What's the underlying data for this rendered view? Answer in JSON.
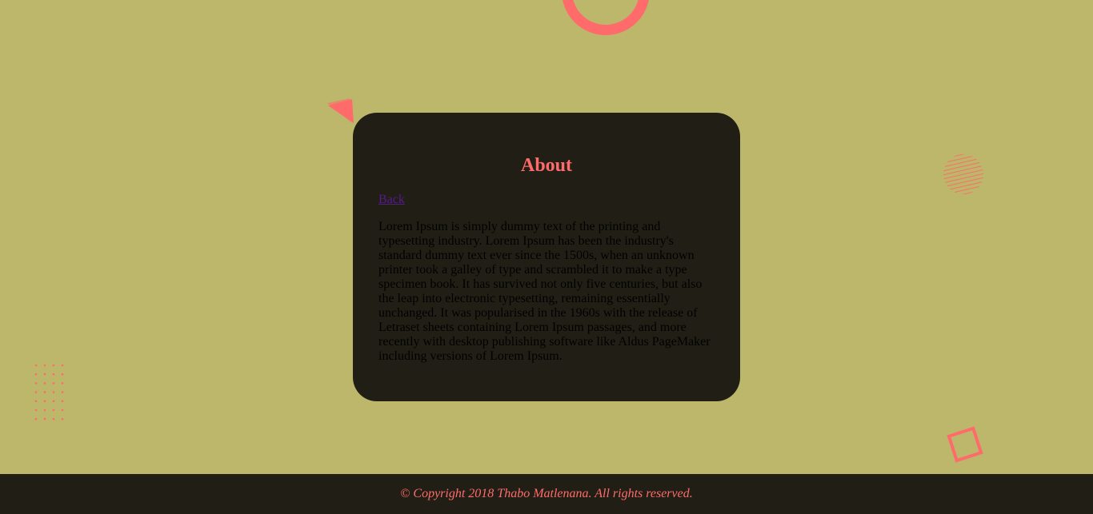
{
  "colors": {
    "background": "#bdb76b",
    "card": "#211f15",
    "accent": "#ff6b6b",
    "link": "#551a8b",
    "text": "#000000"
  },
  "decorations": {
    "ring_icon": "ring-icon",
    "triangle_icon": "triangle-icon",
    "hatched_circle_icon": "hatched-circle-icon",
    "dot_grid_icon": "dot-grid-icon",
    "square_icon": "square-outline-icon"
  },
  "card": {
    "title": "About",
    "back_link": "Back",
    "body": "Lorem Ipsum is simply dummy text of the printing and typesetting industry. Lorem Ipsum has been the industry's standard dummy text ever since the 1500s, when an unknown printer took a galley of type and scrambled it to make a type specimen book. It has survived not only five centuries, but also the leap into electronic typesetting, remaining essentially unchanged. It was popularised in the 1960s with the release of Letraset sheets containing Lorem Ipsum passages, and more recently with desktop publishing software like Aldus PageMaker including versions of Lorem Ipsum."
  },
  "footer": {
    "copyright": "© Copyright 2018 Thabo Matlenana. All rights reserved."
  }
}
